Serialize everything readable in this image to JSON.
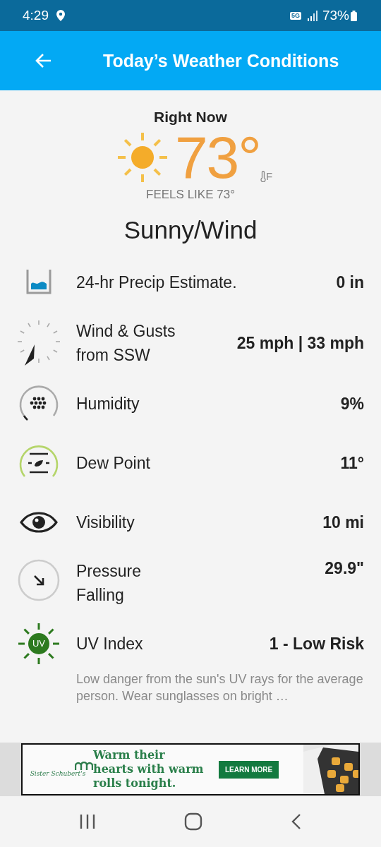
{
  "status_bar": {
    "time": "4:29",
    "network": "5G",
    "battery": "73%"
  },
  "app_bar": {
    "title": "Today’s Weather Conditions"
  },
  "current": {
    "heading": "Right Now",
    "temperature": "73°",
    "unit": "F",
    "feels_like": "FEELS LIKE 73°",
    "condition": "Sunny/Wind"
  },
  "conditions": [
    {
      "kind": "precip",
      "label": "24-hr Precip Estimate.",
      "value": "0 in"
    },
    {
      "kind": "wind",
      "label": "Wind & Gusts\nfrom SSW",
      "value": "25 mph | 33 mph"
    },
    {
      "kind": "humidity",
      "label": "Humidity",
      "value": "9%"
    },
    {
      "kind": "dew",
      "label": "Dew Point",
      "value": "11°"
    },
    {
      "kind": "visibility",
      "label": "Visibility",
      "value": "10 mi"
    },
    {
      "kind": "pressure",
      "label": "Pressure\nFalling",
      "value": "29.9\""
    },
    {
      "kind": "uv",
      "label": "UV Index",
      "value": "1 - Low Risk",
      "badge": "UV",
      "description": "Low danger from the sun's UV rays for the average person. Wear sunglasses on bright …"
    }
  ],
  "ad": {
    "brand": "Sister Schubert's",
    "headline": "Warm their\nhearts with warm\nrolls tonight.",
    "button": "LEARN MORE"
  }
}
